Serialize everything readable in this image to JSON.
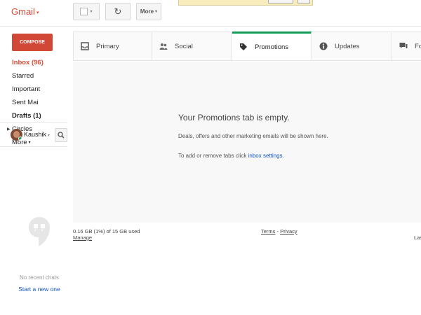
{
  "header": {
    "brand": "Gmail",
    "brand_caret": "▾",
    "refresh_glyph": "↻",
    "more_label": "More",
    "caret": "▾",
    "brand_color": "#dd4b39"
  },
  "sidebar": {
    "compose_label": "COMPOSE",
    "compose_color": "#d14836",
    "items": [
      {
        "label": "Inbox (96)"
      },
      {
        "label": "Starred"
      },
      {
        "label": "Important"
      },
      {
        "label": "Sent Mai"
      },
      {
        "label": "Drafts (1)"
      },
      {
        "label": "Circles"
      },
      {
        "label": "More"
      }
    ],
    "user_name": "Kaushik",
    "no_chats": "No recent chats",
    "start_chat": "Start a new one"
  },
  "tabs": [
    {
      "label": "Primary",
      "icon": "inbox-icon"
    },
    {
      "label": "Social",
      "icon": "people-icon"
    },
    {
      "label": "Promotions",
      "icon": "tag-icon",
      "selected": true
    },
    {
      "label": "Updates",
      "icon": "info-icon"
    },
    {
      "label": "Forur",
      "icon": "forum-icon"
    }
  ],
  "tab_accent_color": "#0f9d58",
  "main": {
    "empty_title": "Your Promotions tab is empty.",
    "empty_desc": "Deals, offers and other marketing emails will be shown here.",
    "help_prefix": "To add or remove tabs click ",
    "help_link": "inbox settings",
    "help_suffix": "."
  },
  "footer": {
    "storage": "0.16 GB (1%) of 15 GB used",
    "manage": "Manage",
    "terms": "Terms",
    "separator": " - ",
    "privacy": "Privacy",
    "last_activity": "Last"
  }
}
